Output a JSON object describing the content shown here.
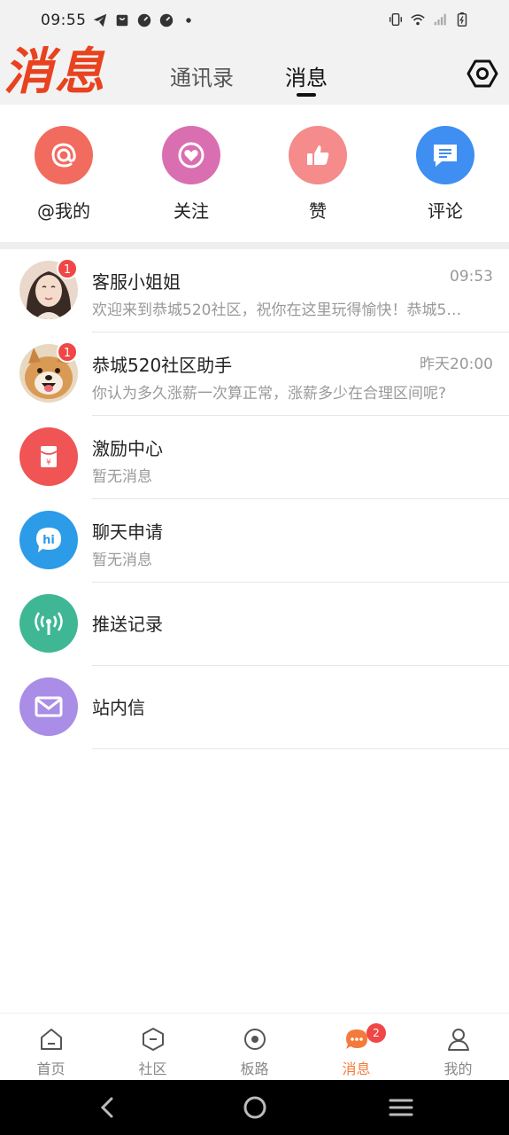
{
  "status_bar": {
    "time": "09:55",
    "left_icons": [
      "telegram-icon",
      "bag-icon",
      "gauge-icon",
      "gauge-icon",
      "dot-icon"
    ],
    "right_icons": [
      "vibrate-icon",
      "wifi-icon",
      "signal-icon",
      "battery-icon"
    ]
  },
  "header": {
    "logo_text": "消息",
    "tabs": [
      {
        "label": "通讯录",
        "active": false
      },
      {
        "label": "消息",
        "active": true
      }
    ],
    "settings_icon": "hexagon-settings-icon"
  },
  "quick_actions": [
    {
      "label": "@我的",
      "icon": "at-icon",
      "color": "#f26b5f"
    },
    {
      "label": "关注",
      "icon": "heart-icon",
      "color": "#d96fb0"
    },
    {
      "label": "赞",
      "icon": "thumb-up-icon",
      "color": "#f58b8b"
    },
    {
      "label": "评论",
      "icon": "comment-icon",
      "color": "#3f8ef2"
    }
  ],
  "conversations": [
    {
      "name": "客服小姐姐",
      "preview": "欢迎来到恭城520社区，祝你在这里玩得愉快！恭城5…",
      "time": "09:53",
      "badge": "1",
      "avatar": "girl-avatar"
    },
    {
      "name": "恭城520社区助手",
      "preview": "你认为多久涨薪一次算正常，涨薪多少在合理区间呢?",
      "time": "昨天20:00",
      "badge": "1",
      "avatar": "dog-avatar"
    },
    {
      "name": "激励中心",
      "preview": "暂无消息",
      "time": "",
      "badge": "",
      "avatar": "red-envelope-icon",
      "color": "#f05454"
    },
    {
      "name": "聊天申请",
      "preview": "暂无消息",
      "time": "",
      "badge": "",
      "avatar": "hi-chat-icon",
      "color": "#2c9be8"
    },
    {
      "name": "推送记录",
      "preview": "",
      "time": "",
      "badge": "",
      "avatar": "broadcast-icon",
      "color": "#3fb795"
    },
    {
      "name": "站内信",
      "preview": "",
      "time": "",
      "badge": "",
      "avatar": "mail-icon",
      "color": "#a98de6"
    }
  ],
  "bottom_nav": [
    {
      "label": "首页",
      "icon": "home-icon",
      "active": false,
      "badge": ""
    },
    {
      "label": "社区",
      "icon": "community-icon",
      "active": false,
      "badge": ""
    },
    {
      "label": "板路",
      "icon": "compass-icon",
      "active": false,
      "badge": ""
    },
    {
      "label": "消息",
      "icon": "message-icon",
      "active": true,
      "badge": "2"
    },
    {
      "label": "我的",
      "icon": "profile-icon",
      "active": false,
      "badge": ""
    }
  ],
  "system_nav": [
    "back-icon",
    "home-circle-icon",
    "menu-icon"
  ],
  "colors": {
    "accent": "#f47a3c",
    "badge": "#f04646",
    "logo": "#e8421f"
  }
}
